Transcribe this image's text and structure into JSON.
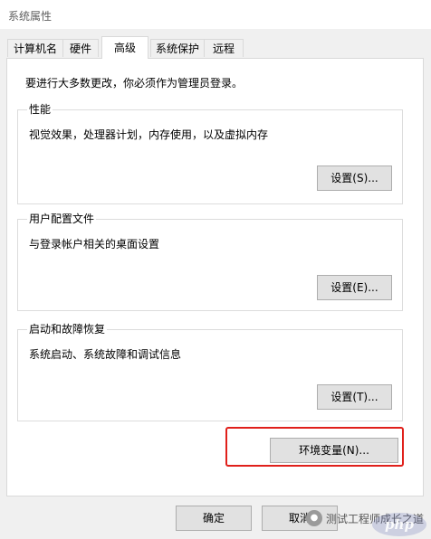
{
  "window": {
    "title": "系统属性"
  },
  "tabs": [
    {
      "label": "计算机名",
      "active": false
    },
    {
      "label": "硬件",
      "active": false
    },
    {
      "label": "高级",
      "active": true
    },
    {
      "label": "系统保护",
      "active": false
    },
    {
      "label": "远程",
      "active": false
    }
  ],
  "advanced": {
    "intro": "要进行大多数更改，你必须作为管理员登录。",
    "performance": {
      "label": "性能",
      "description": "视觉效果，处理器计划，内存使用，以及虚拟内存",
      "button": "设置(S)..."
    },
    "user_profiles": {
      "label": "用户配置文件",
      "description": "与登录帐户相关的桌面设置",
      "button": "设置(E)..."
    },
    "startup_recovery": {
      "label": "启动和故障恢复",
      "description": "系统启动、系统故障和调试信息",
      "button": "设置(T)..."
    },
    "env_button": "环境变量(N)..."
  },
  "dialog_buttons": {
    "ok": "确定",
    "cancel": "取消"
  },
  "watermark": {
    "text": "测试工程师成长之道",
    "logo_text": "php"
  },
  "colors": {
    "highlight": "#e0201b",
    "panel": "#ffffff",
    "dialog": "#f0f0f0"
  }
}
